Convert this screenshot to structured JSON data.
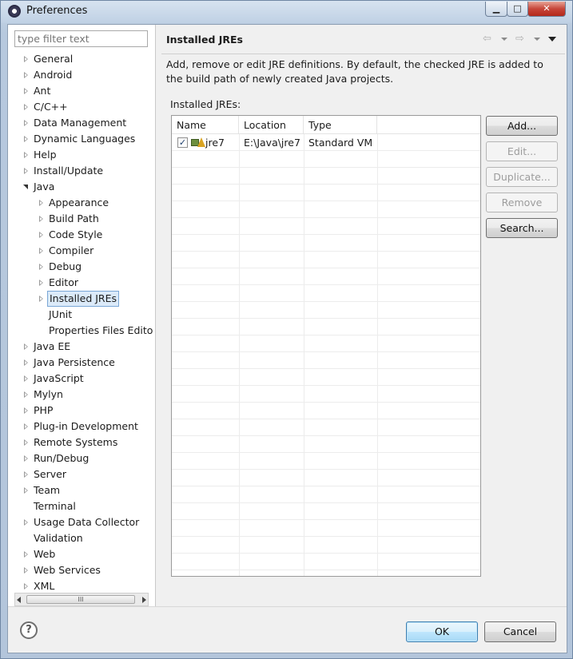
{
  "window": {
    "title": "Preferences"
  },
  "filter": {
    "placeholder": "type filter text"
  },
  "tree": [
    {
      "label": "General",
      "level": 0,
      "arrow": "closed"
    },
    {
      "label": "Android",
      "level": 0,
      "arrow": "closed"
    },
    {
      "label": "Ant",
      "level": 0,
      "arrow": "closed"
    },
    {
      "label": "C/C++",
      "level": 0,
      "arrow": "closed"
    },
    {
      "label": "Data Management",
      "level": 0,
      "arrow": "closed"
    },
    {
      "label": "Dynamic Languages",
      "level": 0,
      "arrow": "closed"
    },
    {
      "label": "Help",
      "level": 0,
      "arrow": "closed"
    },
    {
      "label": "Install/Update",
      "level": 0,
      "arrow": "closed"
    },
    {
      "label": "Java",
      "level": 0,
      "arrow": "open"
    },
    {
      "label": "Appearance",
      "level": 1,
      "arrow": "closed"
    },
    {
      "label": "Build Path",
      "level": 1,
      "arrow": "closed"
    },
    {
      "label": "Code Style",
      "level": 1,
      "arrow": "closed"
    },
    {
      "label": "Compiler",
      "level": 1,
      "arrow": "closed"
    },
    {
      "label": "Debug",
      "level": 1,
      "arrow": "closed"
    },
    {
      "label": "Editor",
      "level": 1,
      "arrow": "closed"
    },
    {
      "label": "Installed JREs",
      "level": 1,
      "arrow": "closed",
      "selected": true
    },
    {
      "label": "JUnit",
      "level": 1,
      "arrow": "none"
    },
    {
      "label": "Properties Files Edito",
      "level": 1,
      "arrow": "none"
    },
    {
      "label": "Java EE",
      "level": 0,
      "arrow": "closed"
    },
    {
      "label": "Java Persistence",
      "level": 0,
      "arrow": "closed"
    },
    {
      "label": "JavaScript",
      "level": 0,
      "arrow": "closed"
    },
    {
      "label": "Mylyn",
      "level": 0,
      "arrow": "closed"
    },
    {
      "label": "PHP",
      "level": 0,
      "arrow": "closed"
    },
    {
      "label": "Plug-in Development",
      "level": 0,
      "arrow": "closed"
    },
    {
      "label": "Remote Systems",
      "level": 0,
      "arrow": "closed"
    },
    {
      "label": "Run/Debug",
      "level": 0,
      "arrow": "closed"
    },
    {
      "label": "Server",
      "level": 0,
      "arrow": "closed"
    },
    {
      "label": "Team",
      "level": 0,
      "arrow": "closed"
    },
    {
      "label": "Terminal",
      "level": 0,
      "arrow": "none"
    },
    {
      "label": "Usage Data Collector",
      "level": 0,
      "arrow": "closed"
    },
    {
      "label": "Validation",
      "level": 0,
      "arrow": "none"
    },
    {
      "label": "Web",
      "level": 0,
      "arrow": "closed"
    },
    {
      "label": "Web Services",
      "level": 0,
      "arrow": "closed"
    },
    {
      "label": "XML",
      "level": 0,
      "arrow": "closed"
    }
  ],
  "scrollbar": {
    "thumb_grip": "III"
  },
  "page": {
    "title": "Installed JREs",
    "description": "Add, remove or edit JRE definitions. By default, the checked JRE is added to the build path of newly created Java projects.",
    "list_label": "Installed JREs:",
    "nav": {
      "back": "⇦",
      "forward": "⇨"
    }
  },
  "table": {
    "columns": [
      "Name",
      "Location",
      "Type"
    ],
    "rows": [
      {
        "checked": true,
        "name": "jre7",
        "location": "E:\\Java\\jre7",
        "type": "Standard VM"
      }
    ],
    "check_glyph": "✓"
  },
  "buttons": {
    "add": "Add...",
    "edit": "Edit...",
    "duplicate": "Duplicate...",
    "remove": "Remove",
    "search": "Search..."
  },
  "footer": {
    "help": "?",
    "ok": "OK",
    "cancel": "Cancel"
  },
  "window_controls": {
    "minimize": "▁",
    "maximize": "□",
    "close": "✕"
  }
}
